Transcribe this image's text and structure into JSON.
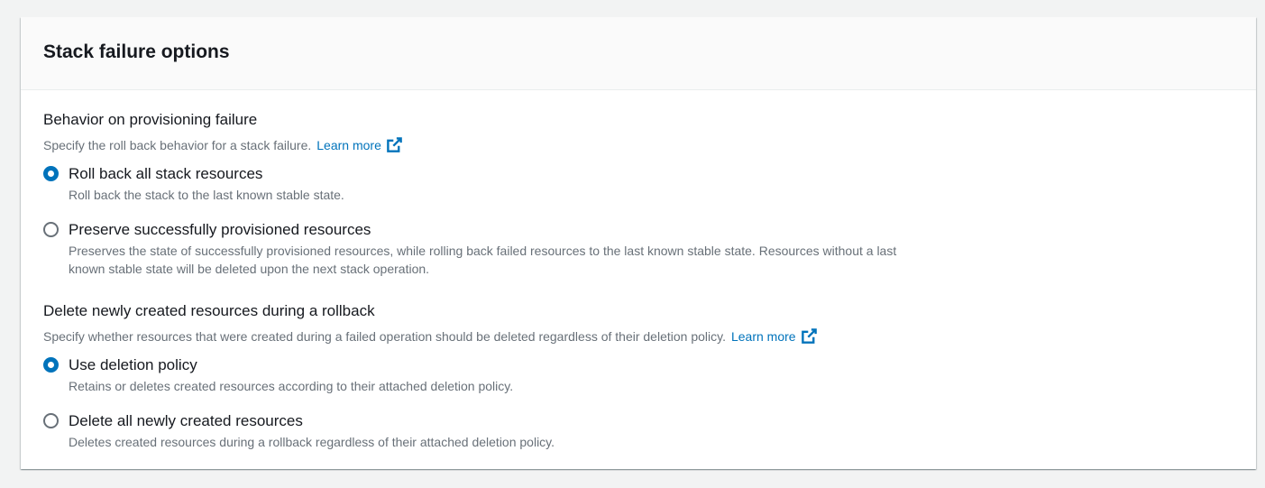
{
  "panel": {
    "title": "Stack failure options"
  },
  "provisioning": {
    "label": "Behavior on provisioning failure",
    "description": "Specify the roll back behavior for a stack failure.",
    "learn_more": "Learn more",
    "options": [
      {
        "label": "Roll back all stack resources",
        "description": "Roll back the stack to the last known stable state.",
        "selected": true
      },
      {
        "label": "Preserve successfully provisioned resources",
        "description": "Preserves the state of successfully provisioned resources, while rolling back failed resources to the last known stable state. Resources without a last known stable state will be deleted upon the next stack operation.",
        "selected": false
      }
    ]
  },
  "rollback_delete": {
    "label": "Delete newly created resources during a rollback",
    "description": "Specify whether resources that were created during a failed operation should be deleted regardless of their deletion policy.",
    "learn_more": "Learn more",
    "options": [
      {
        "label": "Use deletion policy",
        "description": "Retains or deletes created resources according to their attached deletion policy.",
        "selected": true
      },
      {
        "label": "Delete all newly created resources",
        "description": "Deletes created resources during a rollback regardless of their attached deletion policy.",
        "selected": false
      }
    ]
  },
  "icons": {
    "external_link": "external-link-icon"
  },
  "colors": {
    "link": "#0073bb",
    "radio_selected": "#0073bb",
    "text_primary": "#16191f",
    "text_secondary": "#687078"
  }
}
